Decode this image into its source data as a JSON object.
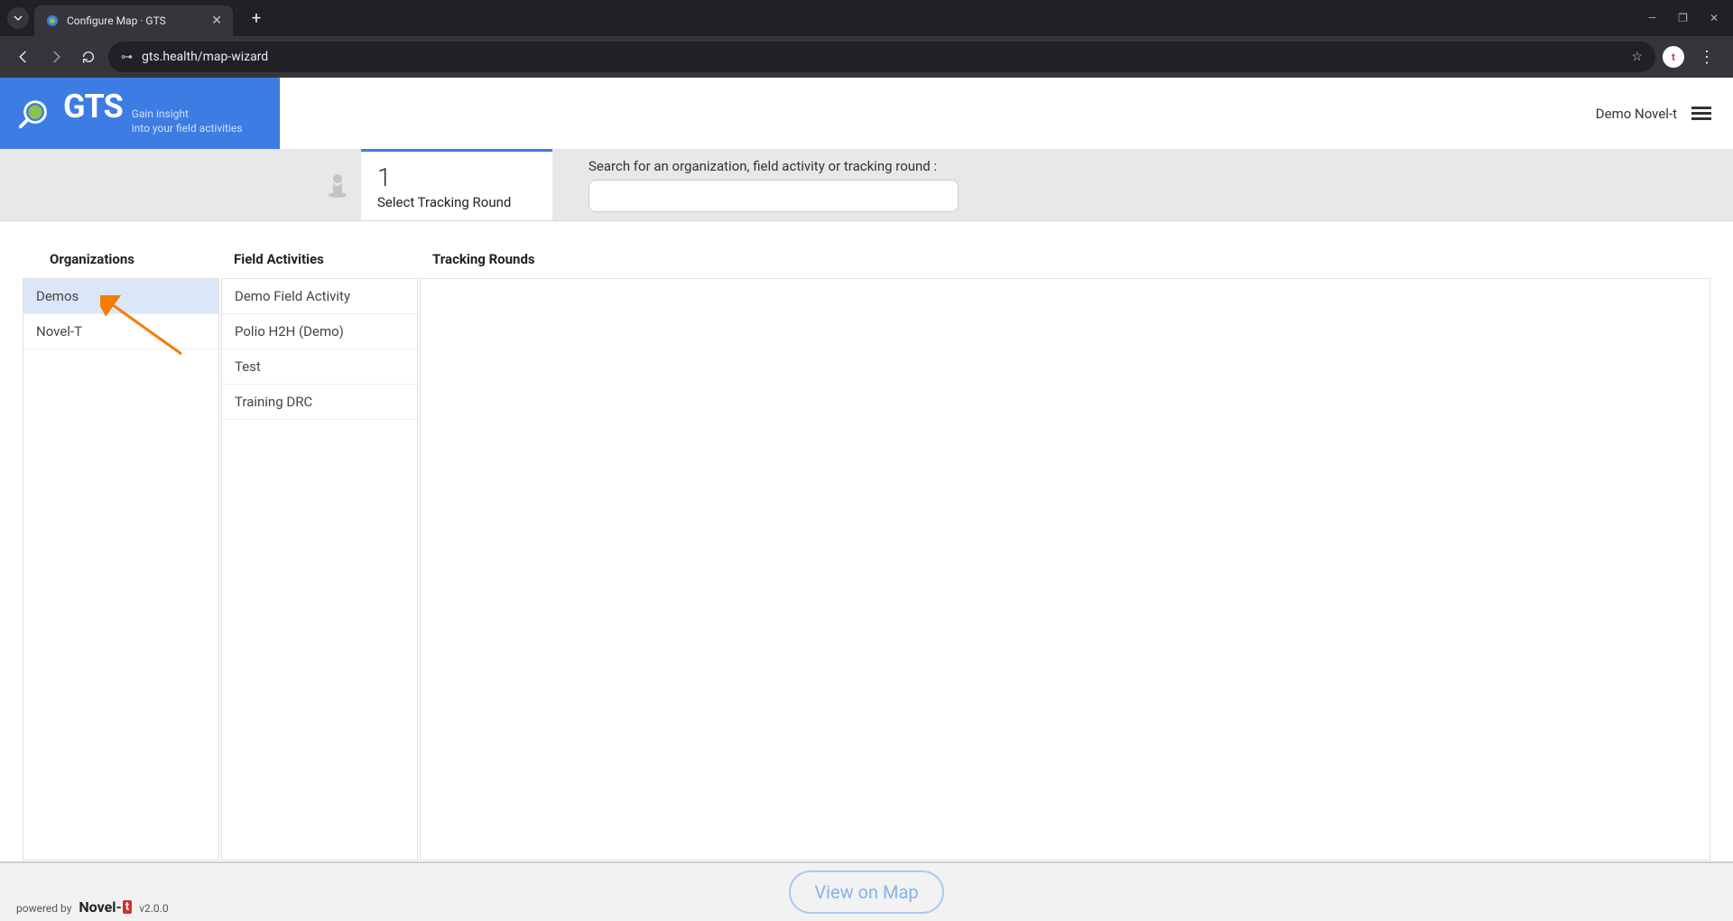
{
  "browser": {
    "tab_title": "Configure Map · GTS",
    "url": "gts.health/map-wizard"
  },
  "header": {
    "logo_main": "GTS",
    "tagline1": "Gain insight",
    "tagline2": "into your field activities",
    "user": "Demo Novel-t"
  },
  "wizard": {
    "step_number": "1",
    "step_label": "Select Tracking Round",
    "search_label": "Search for an organization, field activity or tracking round :",
    "search_value": ""
  },
  "columns": {
    "organizations": {
      "header": "Organizations",
      "items": [
        "Demos",
        "Novel-T"
      ],
      "selected_index": 0
    },
    "field_activities": {
      "header": "Field Activities",
      "items": [
        "Demo Field Activity",
        "Polio H2H (Demo)",
        "Test",
        "Training DRC"
      ]
    },
    "tracking_rounds": {
      "header": "Tracking Rounds",
      "items": []
    }
  },
  "footer": {
    "view_map": "View on Map",
    "powered_prefix": "powered by",
    "brand": "Novel-",
    "brand_suffix": "t",
    "version": "v2.0.0"
  }
}
